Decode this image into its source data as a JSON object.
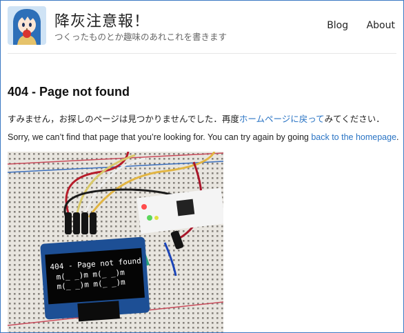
{
  "site": {
    "title": "降灰注意報！",
    "subtitle": "つくったものとか趣味のあれこれを書きます"
  },
  "nav": [
    {
      "label": "Blog"
    },
    {
      "label": "About"
    }
  ],
  "content": {
    "heading": "404 - Page not found",
    "ja_before": "すみません，お探しのページは見つかりませんでした．再度",
    "ja_link": "ホームページに戻って",
    "ja_after": "みてください．",
    "en_before": "Sorry, we can’t find that page that you’re looking for. You can try again by going ",
    "en_link": "back to the homepage",
    "en_after": "."
  },
  "photo": {
    "oled_lines": [
      "404 - Page not found",
      "m(_ _)m   m(_ _)m",
      "m(_ _)m   m(_ _)m"
    ]
  },
  "colors": {
    "link": "#2a74c4",
    "frame_border": "#3a78c2"
  }
}
